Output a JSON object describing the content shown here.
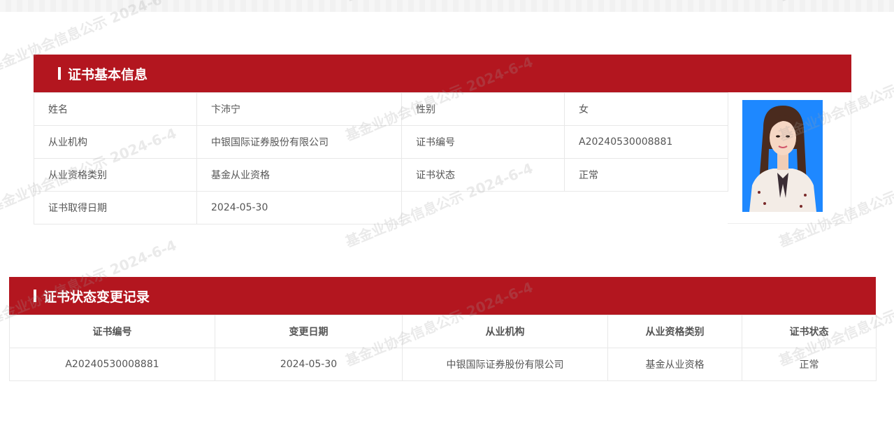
{
  "colors": {
    "header_bg": "#b3161f",
    "header_text": "#ffffff",
    "text": "#555555",
    "border": "#e8e8e8"
  },
  "certificate_info": {
    "title": "证书基本信息",
    "rows": [
      {
        "label1": "姓名",
        "value1": "卞沛宁",
        "label2": "性别",
        "value2": "女"
      },
      {
        "label1": "从业机构",
        "value1": "中银国际证券股份有限公司",
        "label2": "证书编号",
        "value2": "A20240530008881"
      },
      {
        "label1": "从业资格类别",
        "value1": "基金从业资格",
        "label2": "证书状态",
        "value2": "正常"
      },
      {
        "label1": "证书取得日期",
        "value1": "2024-05-30"
      }
    ],
    "photo": {
      "icon": "person-photo",
      "background": "#1e88ff"
    }
  },
  "change_records": {
    "title": "证书状态变更记录",
    "columns": [
      "证书编号",
      "变更日期",
      "从业机构",
      "从业资格类别",
      "证书状态"
    ],
    "rows": [
      [
        "A20240530008881",
        "2024-05-30",
        "中银国际证券股份有限公司",
        "基金从业资格",
        "正常"
      ]
    ]
  },
  "watermark": {
    "text": "基金业协会信息公示 2024-6-4"
  }
}
